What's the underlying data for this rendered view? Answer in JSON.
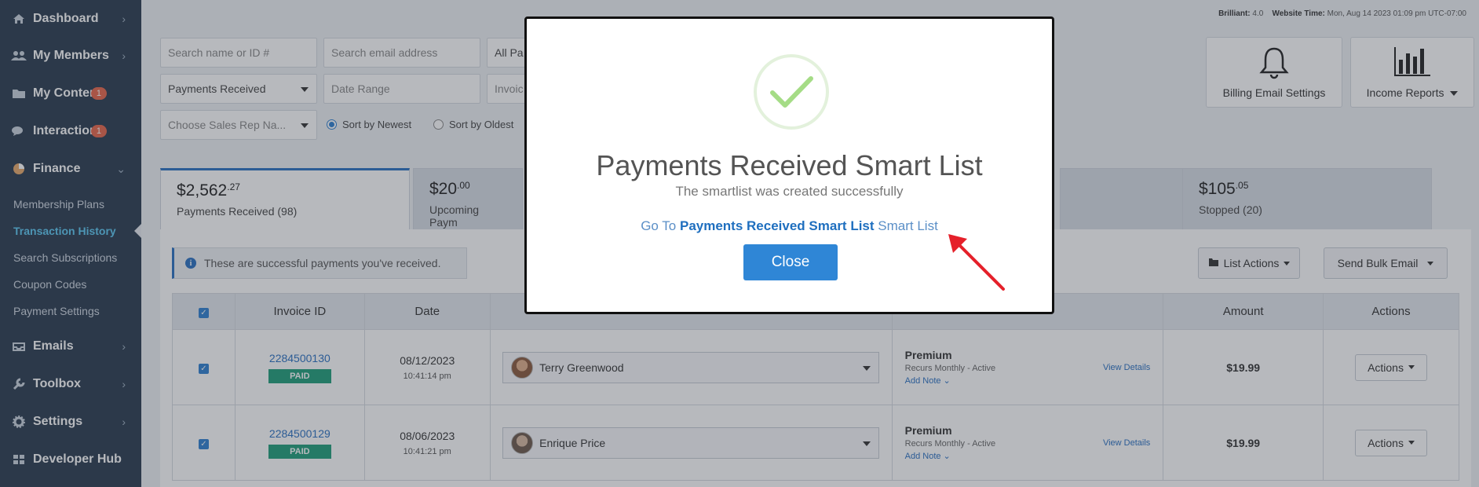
{
  "sidebar": {
    "items": [
      {
        "label": "Dashboard",
        "icon": "home-icon"
      },
      {
        "label": "My Members",
        "icon": "users-icon"
      },
      {
        "label": "My Content",
        "icon": "folder-icon",
        "count": "1"
      },
      {
        "label": "Interactions",
        "icon": "comments-icon",
        "count": "1"
      },
      {
        "label": "Finance",
        "icon": "pie-chart-icon"
      }
    ],
    "finance_sub": [
      {
        "label": "Membership Plans"
      },
      {
        "label": "Transaction History",
        "active": true
      },
      {
        "label": "Search Subscriptions"
      },
      {
        "label": "Coupon Codes"
      },
      {
        "label": "Payment Settings"
      }
    ],
    "bottom_items": [
      {
        "label": "Emails",
        "icon": "inbox-icon"
      },
      {
        "label": "Toolbox",
        "icon": "wrench-icon"
      },
      {
        "label": "Settings",
        "icon": "gear-icon"
      },
      {
        "label": "Developer Hub",
        "icon": "grid-icon"
      }
    ]
  },
  "topinfo": {
    "brilliant_label": "Brilliant:",
    "brilliant_value": "4.0",
    "time_label": "Website Time:",
    "time_value": "Mon, Aug 14 2023 01:09 pm UTC-07:00"
  },
  "filters": {
    "search_name_placeholder": "Search name or ID #",
    "search_email_placeholder": "Search email address",
    "all_pa": "All Pa",
    "type_value": "Payments Received",
    "date_range_placeholder": "Date Range",
    "invoic": "Invoic",
    "sales_rep_placeholder": "Choose Sales Rep Na...",
    "sort_newest": "Sort by Newest",
    "sort_oldest": "Sort by Oldest"
  },
  "buttons": {
    "billing_email_settings": "Billing Email Settings",
    "income_reports": "Income Reports",
    "list_actions": "List Actions",
    "send_bulk_email": "Send Bulk Email"
  },
  "stat_tabs": [
    {
      "amount": "$2,562",
      "cents": ".27",
      "label": "Payments Received (98)"
    },
    {
      "amount": "$20",
      "cents": ".00",
      "label": "Upcoming Paym"
    },
    {
      "amount": "$105",
      "cents": ".05",
      "label": "Stopped (20)"
    }
  ],
  "notice": "These are successful payments you've received.",
  "table": {
    "headers": [
      "Invoice ID",
      "Date",
      "Amount",
      "Actions"
    ],
    "rows": [
      {
        "invoice": "2284500130",
        "status": "PAID",
        "date": "08/12/2023",
        "time": "10:41:14 pm",
        "member": "Terry Greenwood",
        "plan": "Premium",
        "recurs": "Recurs Monthly - Active",
        "add_note": "Add Note ⌄",
        "view_details": "View Details",
        "amount": "$19.99",
        "actions": "Actions"
      },
      {
        "invoice": "2284500129",
        "status": "PAID",
        "date": "08/06/2023",
        "time": "10:41:21 pm",
        "member": "Enrique Price",
        "plan": "Premium",
        "recurs": "Recurs Monthly - Active",
        "add_note": "Add Note ⌄",
        "view_details": "View Details",
        "amount": "$19.99",
        "actions": "Actions"
      }
    ]
  },
  "modal": {
    "title": "Payments Received Smart List",
    "subtitle": "The smartlist was created successfully",
    "goto_prefix": "Go To",
    "goto_link": "Payments Received Smart List",
    "goto_suffix": "Smart List",
    "close": "Close"
  }
}
